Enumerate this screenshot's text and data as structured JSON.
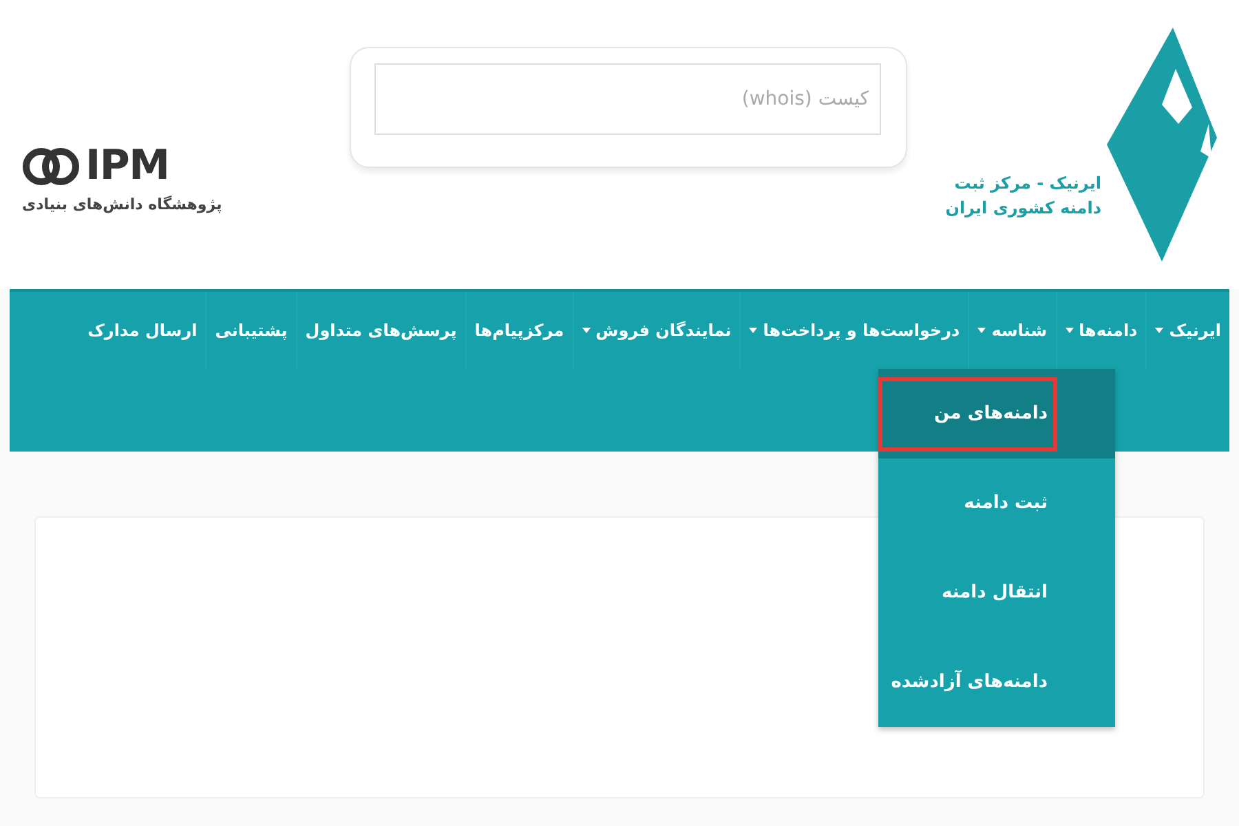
{
  "header": {
    "brand_right": {
      "line_1": "ایرنیک - مرکز ثبت",
      "line_2": "دامنه کشوری ایران"
    },
    "whois": {
      "placeholder": "کیست (whois)"
    },
    "brand_left": {
      "logo_text": "IPM",
      "subtitle": "پژوهشگاه دانش‌های بنیادی"
    }
  },
  "nav": {
    "items": [
      {
        "label": "ایرنیک",
        "has_menu": true
      },
      {
        "label": "دامنه‌ها",
        "has_menu": true
      },
      {
        "label": "شناسه",
        "has_menu": true
      },
      {
        "label": "درخواست‌ها و پرداخت‌ها",
        "has_menu": true
      },
      {
        "label": "نمایندگان فروش",
        "has_menu": true
      },
      {
        "label": "مرکزپیام‌ها",
        "has_menu": false
      },
      {
        "label": "پرسش‌های متداول",
        "has_menu": false
      },
      {
        "label": "پشتیبانی",
        "has_menu": false
      },
      {
        "label": "ارسال مدارک",
        "has_menu": false
      }
    ]
  },
  "dropdown": {
    "items": [
      {
        "label": "دامنه‌های من",
        "selected": true,
        "highlighted": true
      },
      {
        "label": "ثبت دامنه",
        "selected": false,
        "highlighted": false
      },
      {
        "label": "انتقال دامنه",
        "selected": false,
        "highlighted": false
      },
      {
        "label": "دامنه‌های آزادشده",
        "selected": false,
        "highlighted": false
      }
    ]
  }
}
